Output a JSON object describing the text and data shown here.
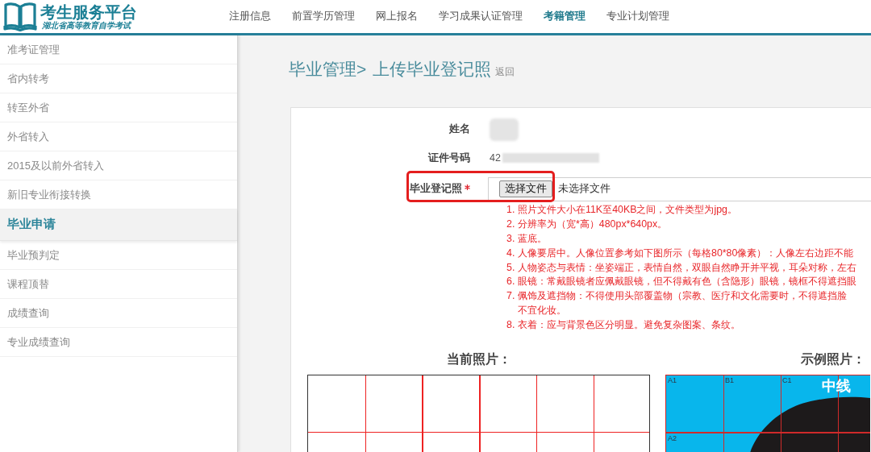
{
  "header": {
    "logo": {
      "title": "考生服务平台",
      "subtitle": "湖北省高等教育自学考试"
    },
    "nav": [
      {
        "label": "注册信息",
        "selected": false
      },
      {
        "label": "前置学历管理",
        "selected": false
      },
      {
        "label": "网上报名",
        "selected": false
      },
      {
        "label": "学习成果认证管理",
        "selected": false
      },
      {
        "label": "考籍管理",
        "selected": true
      },
      {
        "label": "专业计划管理",
        "selected": false
      }
    ]
  },
  "sidebar": {
    "items": [
      {
        "label": "准考证管理",
        "selected": false
      },
      {
        "label": "省内转考",
        "selected": false
      },
      {
        "label": "转至外省",
        "selected": false
      },
      {
        "label": "外省转入",
        "selected": false
      },
      {
        "label": "2015及以前外省转入",
        "selected": false
      },
      {
        "label": "新旧专业衔接转换",
        "selected": false
      },
      {
        "label": "毕业申请",
        "selected": true
      },
      {
        "label": "毕业预判定",
        "selected": false
      },
      {
        "label": "课程顶替",
        "selected": false
      },
      {
        "label": "成绩查询",
        "selected": false
      },
      {
        "label": "专业成绩查询",
        "selected": false
      }
    ]
  },
  "breadcrumb": {
    "parent": "毕业管理>",
    "current": "上传毕业登记照",
    "back_link": "返回"
  },
  "form": {
    "fields": [
      {
        "kind": "blurred",
        "label": "姓名",
        "required": false,
        "highlighted": false
      },
      {
        "kind": "partly_blurred",
        "label": "证件号码",
        "value": "42",
        "required": false,
        "highlighted": false
      },
      {
        "kind": "file",
        "label": "毕业登记照",
        "required": true,
        "highlighted": true,
        "button": "选择文件",
        "status": "未选择文件"
      }
    ],
    "requirements": [
      {
        "number": "1.",
        "text": "照片文件大小在11K至40KB之间，文件类型为jpg。"
      },
      {
        "number": "2.",
        "text": "分辨率为（宽*高）480px*640px。"
      },
      {
        "number": "3.",
        "text": "蓝底。"
      },
      {
        "number": "4.",
        "text": "人像要居中。人像位置参考如下图所示（每格80*80像素）：人像左右边距不能"
      },
      {
        "number": "5.",
        "text": "人物姿态与表情：坐姿端正，表情自然，双眼自然睁开并平视，耳朵对称，左右"
      },
      {
        "number": "6.",
        "text": "眼镜：常戴眼镜者应佩戴眼镜，但不得戴有色（含隐形）眼镜，镜框不得遮挡眼"
      },
      {
        "number": "7.",
        "text": "佩饰及遮挡物：不得使用头部覆盖物（宗教、医疗和文化需要时，不得遮挡脸",
        "continuation": "不宜化妆。"
      },
      {
        "number": "8.",
        "text": "衣着：应与背景色区分明显。避免复杂图案、条纹。"
      }
    ]
  },
  "photos": {
    "current": {
      "title": "当前照片："
    },
    "example": {
      "title": "示例照片：",
      "grid_labels": [
        "A1",
        "B1",
        "C1",
        "A2"
      ],
      "center_label": "中线"
    }
  }
}
